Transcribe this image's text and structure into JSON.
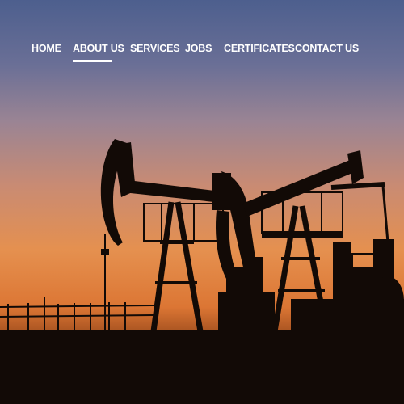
{
  "nav": {
    "active_index": 1,
    "items": [
      {
        "label": "HOME"
      },
      {
        "label": "ABOUT US"
      },
      {
        "label": "SERVICES"
      },
      {
        "label": "JOBS"
      },
      {
        "label": "CERTIFICATES"
      },
      {
        "label": "CONTACT US"
      }
    ]
  },
  "hero": {
    "image": "oil-pumpjacks-sunset-silhouette",
    "sky_colors": [
      "#4d5f8e",
      "#8a7d98",
      "#cf8c6c",
      "#e88f4c",
      "#d86a2a"
    ],
    "silhouette_color": "#120a06"
  }
}
